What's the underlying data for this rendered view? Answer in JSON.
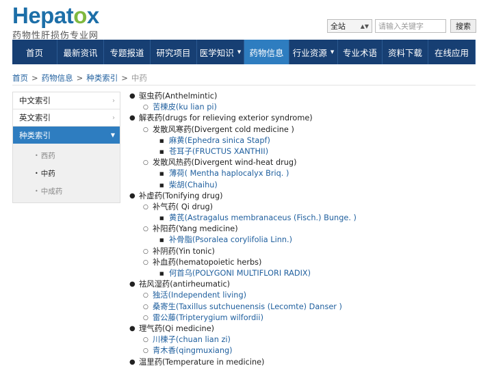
{
  "logo": {
    "word_a": "Hepat",
    "word_o": "o",
    "word_b": "x",
    "subtitle": "药物性肝损伤专业网"
  },
  "search": {
    "scope": "全站",
    "placeholder": "请输入关键字",
    "button": "搜索"
  },
  "nav": [
    {
      "label": "首页",
      "dropdown": false,
      "active": false,
      "w": 66
    },
    {
      "label": "最新资讯",
      "dropdown": false,
      "active": false,
      "w": 68
    },
    {
      "label": "专题报道",
      "dropdown": false,
      "active": false,
      "w": 68
    },
    {
      "label": "研究项目",
      "dropdown": false,
      "active": false,
      "w": 68
    },
    {
      "label": "医学知识",
      "dropdown": true,
      "active": false,
      "w": 69
    },
    {
      "label": "药物信息",
      "dropdown": false,
      "active": true,
      "w": 66
    },
    {
      "label": "行业资源",
      "dropdown": true,
      "active": false,
      "w": 71
    },
    {
      "label": "专业术语",
      "dropdown": false,
      "active": false,
      "w": 65
    },
    {
      "label": "资料下载",
      "dropdown": false,
      "active": false,
      "w": 67
    },
    {
      "label": "在线应用",
      "dropdown": false,
      "active": false,
      "w": 69
    }
  ],
  "breadcrumb": {
    "items": [
      "首页",
      "药物信息",
      "种类索引"
    ],
    "current": "中药"
  },
  "sidebar": {
    "items": [
      "中文索引",
      "英文索引",
      "种类索引"
    ],
    "subitems": [
      "西药",
      "中药",
      "中成药"
    ]
  },
  "tree": [
    {
      "level": 1,
      "text": "驱虫药(Anthelmintic)",
      "link": false
    },
    {
      "level": 2,
      "text": "苦楝皮(ku lian pi)",
      "link": true
    },
    {
      "level": 1,
      "text": "解表药(drugs for relieving exterior syndrome)",
      "link": false
    },
    {
      "level": 2,
      "text": "发散风寒药(Divergent cold medicine )",
      "link": false
    },
    {
      "level": 3,
      "text": "麻黄(Ephedra sinica Stapf)",
      "link": true
    },
    {
      "level": 3,
      "text": "苍耳子(FRUCTUS XANTHII)",
      "link": true
    },
    {
      "level": 2,
      "text": "发散风热药(Divergent wind-heat drug)",
      "link": false
    },
    {
      "level": 3,
      "text": "薄荷( Mentha haplocalyx Briq. )",
      "link": true
    },
    {
      "level": 3,
      "text": "柴胡(Chaihu)",
      "link": true
    },
    {
      "level": 1,
      "text": "补虚药(Tonifying drug)",
      "link": false
    },
    {
      "level": 2,
      "text": "补气药( Qi drug)",
      "link": false
    },
    {
      "level": 3,
      "text": "黄芪(Astragalus membranaceus (Fisch.) Bunge. )",
      "link": true
    },
    {
      "level": 2,
      "text": "补阳药(Yang medicine)",
      "link": false
    },
    {
      "level": 3,
      "text": "补骨脂(Psoralea corylifolia Linn.)",
      "link": true
    },
    {
      "level": 2,
      "text": "补阴药(Yin tonic)",
      "link": false
    },
    {
      "level": 2,
      "text": "补血药(hematopoietic herbs)",
      "link": false
    },
    {
      "level": 3,
      "text": "何首乌(POLYGONI MULTIFLORI RADIX)",
      "link": true
    },
    {
      "level": 1,
      "text": "祛风湿药(antirheumatic)",
      "link": false
    },
    {
      "level": 2,
      "text": "独活(Independent living)",
      "link": true
    },
    {
      "level": 2,
      "text": "桑寄生(Taxillus sutchuenensis (Lecomte) Danser )",
      "link": true
    },
    {
      "level": 2,
      "text": "雷公藤(Tripterygium wilfordii)",
      "link": true
    },
    {
      "level": 1,
      "text": "理气药(Qi medicine)",
      "link": false
    },
    {
      "level": 2,
      "text": "川楝子(chuan lian zi)",
      "link": true
    },
    {
      "level": 2,
      "text": "青木香(qingmuxiang)",
      "link": true
    },
    {
      "level": 1,
      "text": "温里药(Temperature in medicine)",
      "link": false
    }
  ]
}
